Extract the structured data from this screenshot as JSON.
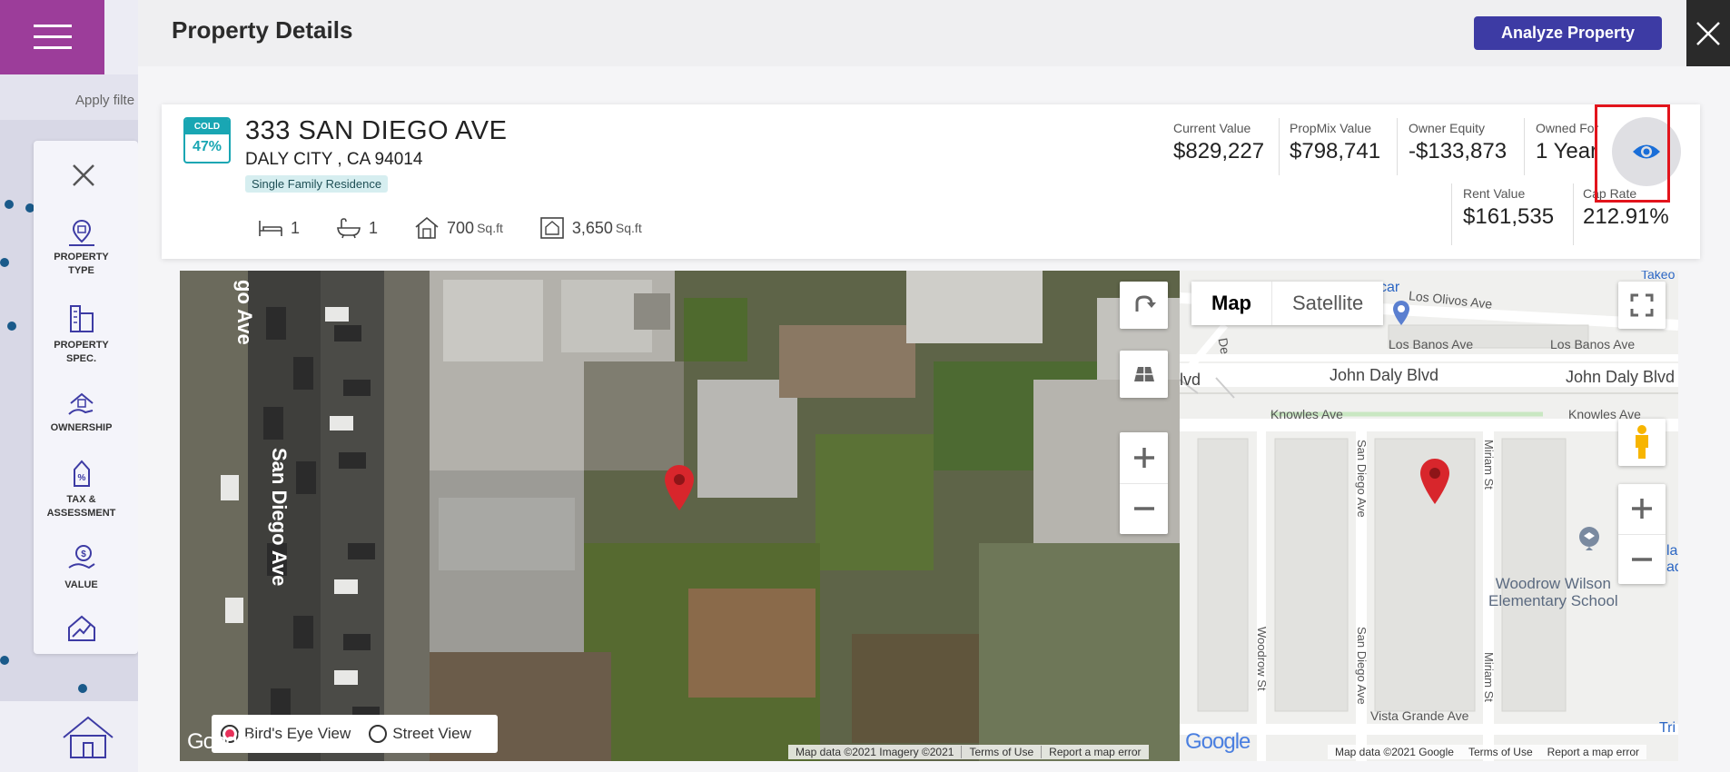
{
  "background": {
    "filter_hint": "Apply filte",
    "panel_items": [
      {
        "label": "PROPERTY\nTYPE",
        "icon": "property-type-icon"
      },
      {
        "label": "PROPERTY\nSPEC.",
        "icon": "property-spec-icon"
      },
      {
        "label": "OWNERSHIP",
        "icon": "ownership-icon"
      },
      {
        "label": "TAX &\nASSESSMENT",
        "icon": "tax-assessment-icon"
      },
      {
        "label": "VALUE",
        "icon": "value-icon"
      },
      {
        "label": "",
        "icon": "trend-icon"
      }
    ]
  },
  "modal": {
    "title": "Property Details",
    "analyze_button": "Analyze Property"
  },
  "property": {
    "badge_status": "COLD",
    "badge_score": "47%",
    "address_line1": "333 SAN DIEGO AVE",
    "address_line2": "DALY CITY , CA 94014",
    "type": "Single Family Residence",
    "beds": "1",
    "baths": "1",
    "building_area": "700",
    "lot_area": "3,650",
    "area_unit": "Sq.ft"
  },
  "metrics": {
    "current_value": {
      "label": "Current Value",
      "value": "$829,227"
    },
    "propmix_value": {
      "label": "PropMix Value",
      "value": "$798,741"
    },
    "owner_equity": {
      "label": "Owner Equity",
      "value": "-$133,873"
    },
    "owned_for": {
      "label": "Owned For",
      "value": "1 Year"
    },
    "rent_value": {
      "label": "Rent Value",
      "value": "$161,535"
    },
    "cap_rate": {
      "label": "Cap Rate",
      "value": "212.91%"
    }
  },
  "satellite_map": {
    "street_label": "San Diego Ave",
    "street_label_top": "go Ave",
    "view_options": [
      "Bird's Eye View",
      "Street View"
    ],
    "selected_view": "Bird's Eye View",
    "attribution": [
      "Map data ©2021 Imagery ©2021",
      "Terms of Use",
      "Report a map error"
    ],
    "logo": "Google"
  },
  "road_map": {
    "type_buttons": [
      "Map",
      "Satellite"
    ],
    "labels": {
      "los_olivos": "Los Olivos Ave",
      "los_banos_1": "Los Banos Ave",
      "los_banos_2": "Los Banos Ave",
      "john_daly_1": "John Daly Blvd",
      "john_daly_2": "John Daly Blvd",
      "knowles_1": "Knowles Ave",
      "knowles_2": "Knowles Ave",
      "san_diego_1": "San Diego Ave",
      "san_diego_2": "San Diego Ave",
      "miriam_1": "Miriam St",
      "miriam_2": "Miriam St",
      "woodrow": "Woodrow St",
      "vista_grande": "Vista Grande Ave",
      "school": "Woodrow Wilson\nElementary School",
      "car_partial": "car",
      "takeout_partial": "Takeo",
      "lvd_partial": "lvd",
      "tri_partial": "Tri C",
      "la_partial": "la\nad",
      "de_partial": "De"
    },
    "attribution": [
      "Map data ©2021 Google",
      "Terms of Use",
      "Report a map error"
    ],
    "logo": "Google"
  },
  "colors": {
    "brand_purple": "#9c3d9a",
    "analyze_button": "#3d3ba4",
    "badge_teal": "#19a6b3",
    "highlight_red": "#e2141c",
    "pin_red": "#d8262c"
  }
}
